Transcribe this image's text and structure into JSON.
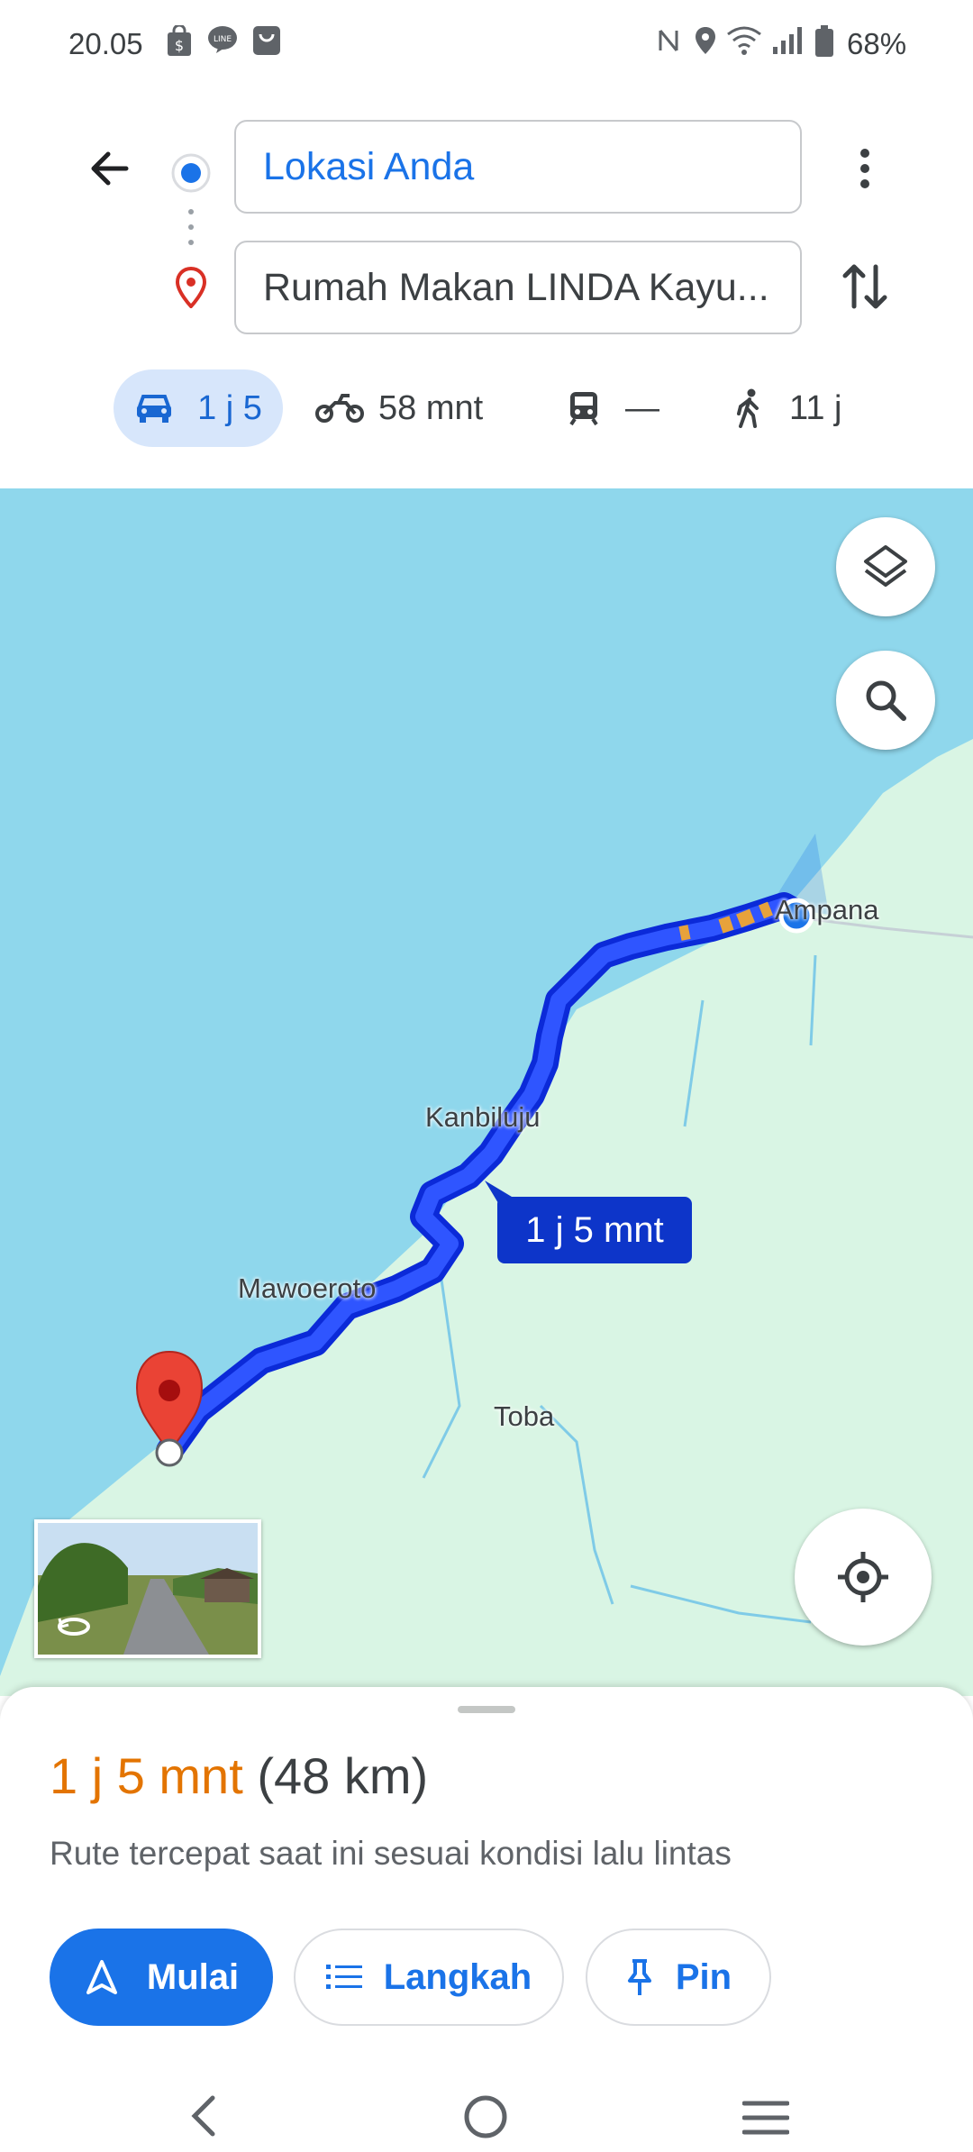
{
  "status_bar": {
    "time": "20.05",
    "battery": "68%",
    "left_icons": [
      "shopping-bag-icon",
      "line-chat-icon",
      "store-icon"
    ],
    "right_icons": [
      "nfc-icon",
      "location-icon",
      "wifi-icon",
      "signal-icon",
      "battery-icon"
    ]
  },
  "directions": {
    "origin": "Lokasi Anda",
    "destination": "Rumah Makan LINDA Kayu...",
    "modes": [
      {
        "name": "car",
        "value": "1 j 5",
        "selected": true
      },
      {
        "name": "motorcycle",
        "value": "58 mnt"
      },
      {
        "name": "transit",
        "value": "—"
      },
      {
        "name": "walk",
        "value": "11 j"
      }
    ]
  },
  "map": {
    "labels": {
      "ampana": "Ampana",
      "kanbiluju": "Kanbiluju",
      "mawoeroto": "Mawoeroto",
      "toba": "Toba"
    },
    "route_time": "1 j 5 mnt",
    "colors": {
      "water": "#8fd7ec",
      "land": "#d9f5e4",
      "route": "#1a3dff",
      "traffic": "#e8a23b"
    }
  },
  "route_summary": {
    "duration": "1 j 5 mnt",
    "distance": "(48 km)",
    "note": "Rute tercepat saat ini sesuai kondisi lalu lintas"
  },
  "actions": {
    "start": "Mulai",
    "steps": "Langkah",
    "pin": "Pin"
  },
  "accent": "#1a73e8"
}
